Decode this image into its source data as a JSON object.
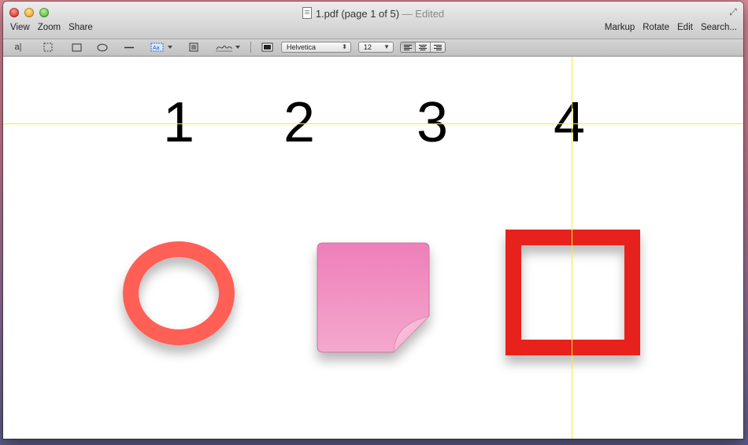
{
  "window": {
    "title": "1.pdf (page 1 of 5)",
    "edited": "— Edited"
  },
  "menu": {
    "left": [
      "View",
      "Zoom",
      "Share"
    ],
    "right": [
      "Markup",
      "Rotate",
      "Edit",
      "Search..."
    ]
  },
  "toolbar": {
    "text_select_label": "a|",
    "font": "Helvetica",
    "font_size": "12"
  },
  "page": {
    "numbers": [
      "1",
      "2",
      "3",
      "4"
    ]
  },
  "colors": {
    "circle": "#ff5e55",
    "note": "#ef88bd",
    "square": "#e7201a",
    "guide": "#f6ea3a"
  }
}
